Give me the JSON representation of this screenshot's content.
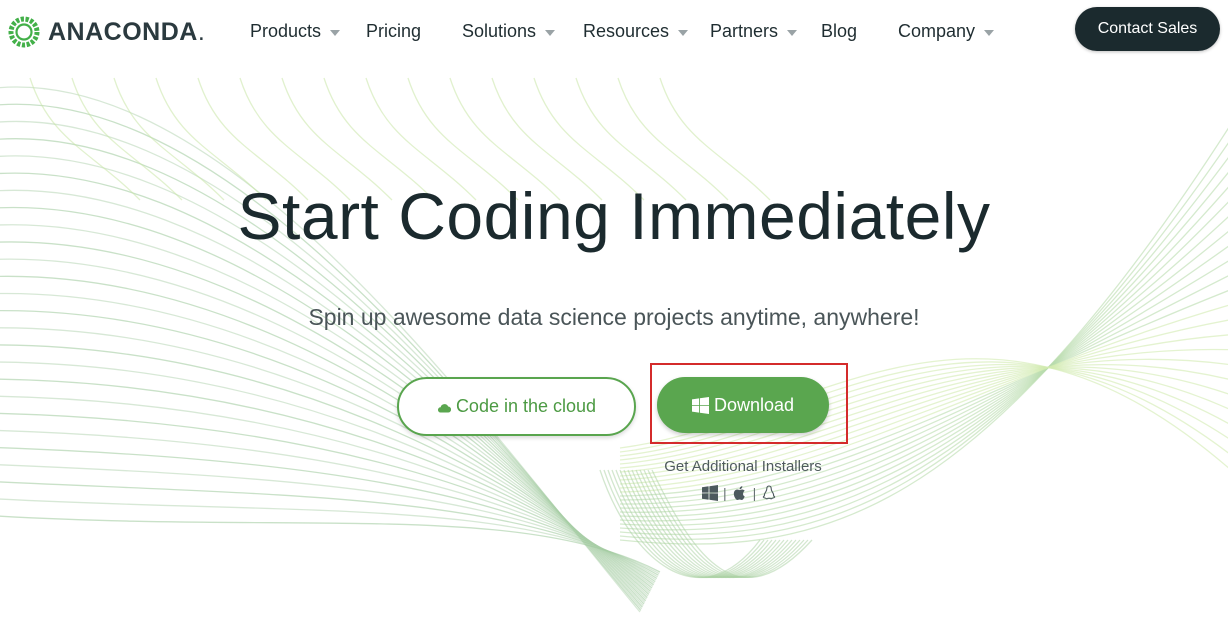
{
  "brand": {
    "name": "ANACONDA",
    "dot": "."
  },
  "nav": {
    "items": [
      {
        "label": "Products",
        "dropdown": true
      },
      {
        "label": "Pricing",
        "dropdown": false
      },
      {
        "label": "Solutions",
        "dropdown": true
      },
      {
        "label": "Resources",
        "dropdown": true
      },
      {
        "label": "Partners",
        "dropdown": true
      },
      {
        "label": "Blog",
        "dropdown": false
      },
      {
        "label": "Company",
        "dropdown": true
      }
    ],
    "cta_label": "Contact Sales"
  },
  "hero": {
    "title": "Start Coding Immediately",
    "subtitle": "Spin up awesome data science projects anytime, anywhere!",
    "cloud_button_label": "Code in the cloud",
    "download_button_label": "Download",
    "installers_label": "Get Additional Installers",
    "os_icons": [
      "windows-icon",
      "apple-icon",
      "linux-icon"
    ]
  },
  "colors": {
    "brand_green": "#5aa64f",
    "dark": "#1b2a2e",
    "highlight": "#d42b2b"
  }
}
